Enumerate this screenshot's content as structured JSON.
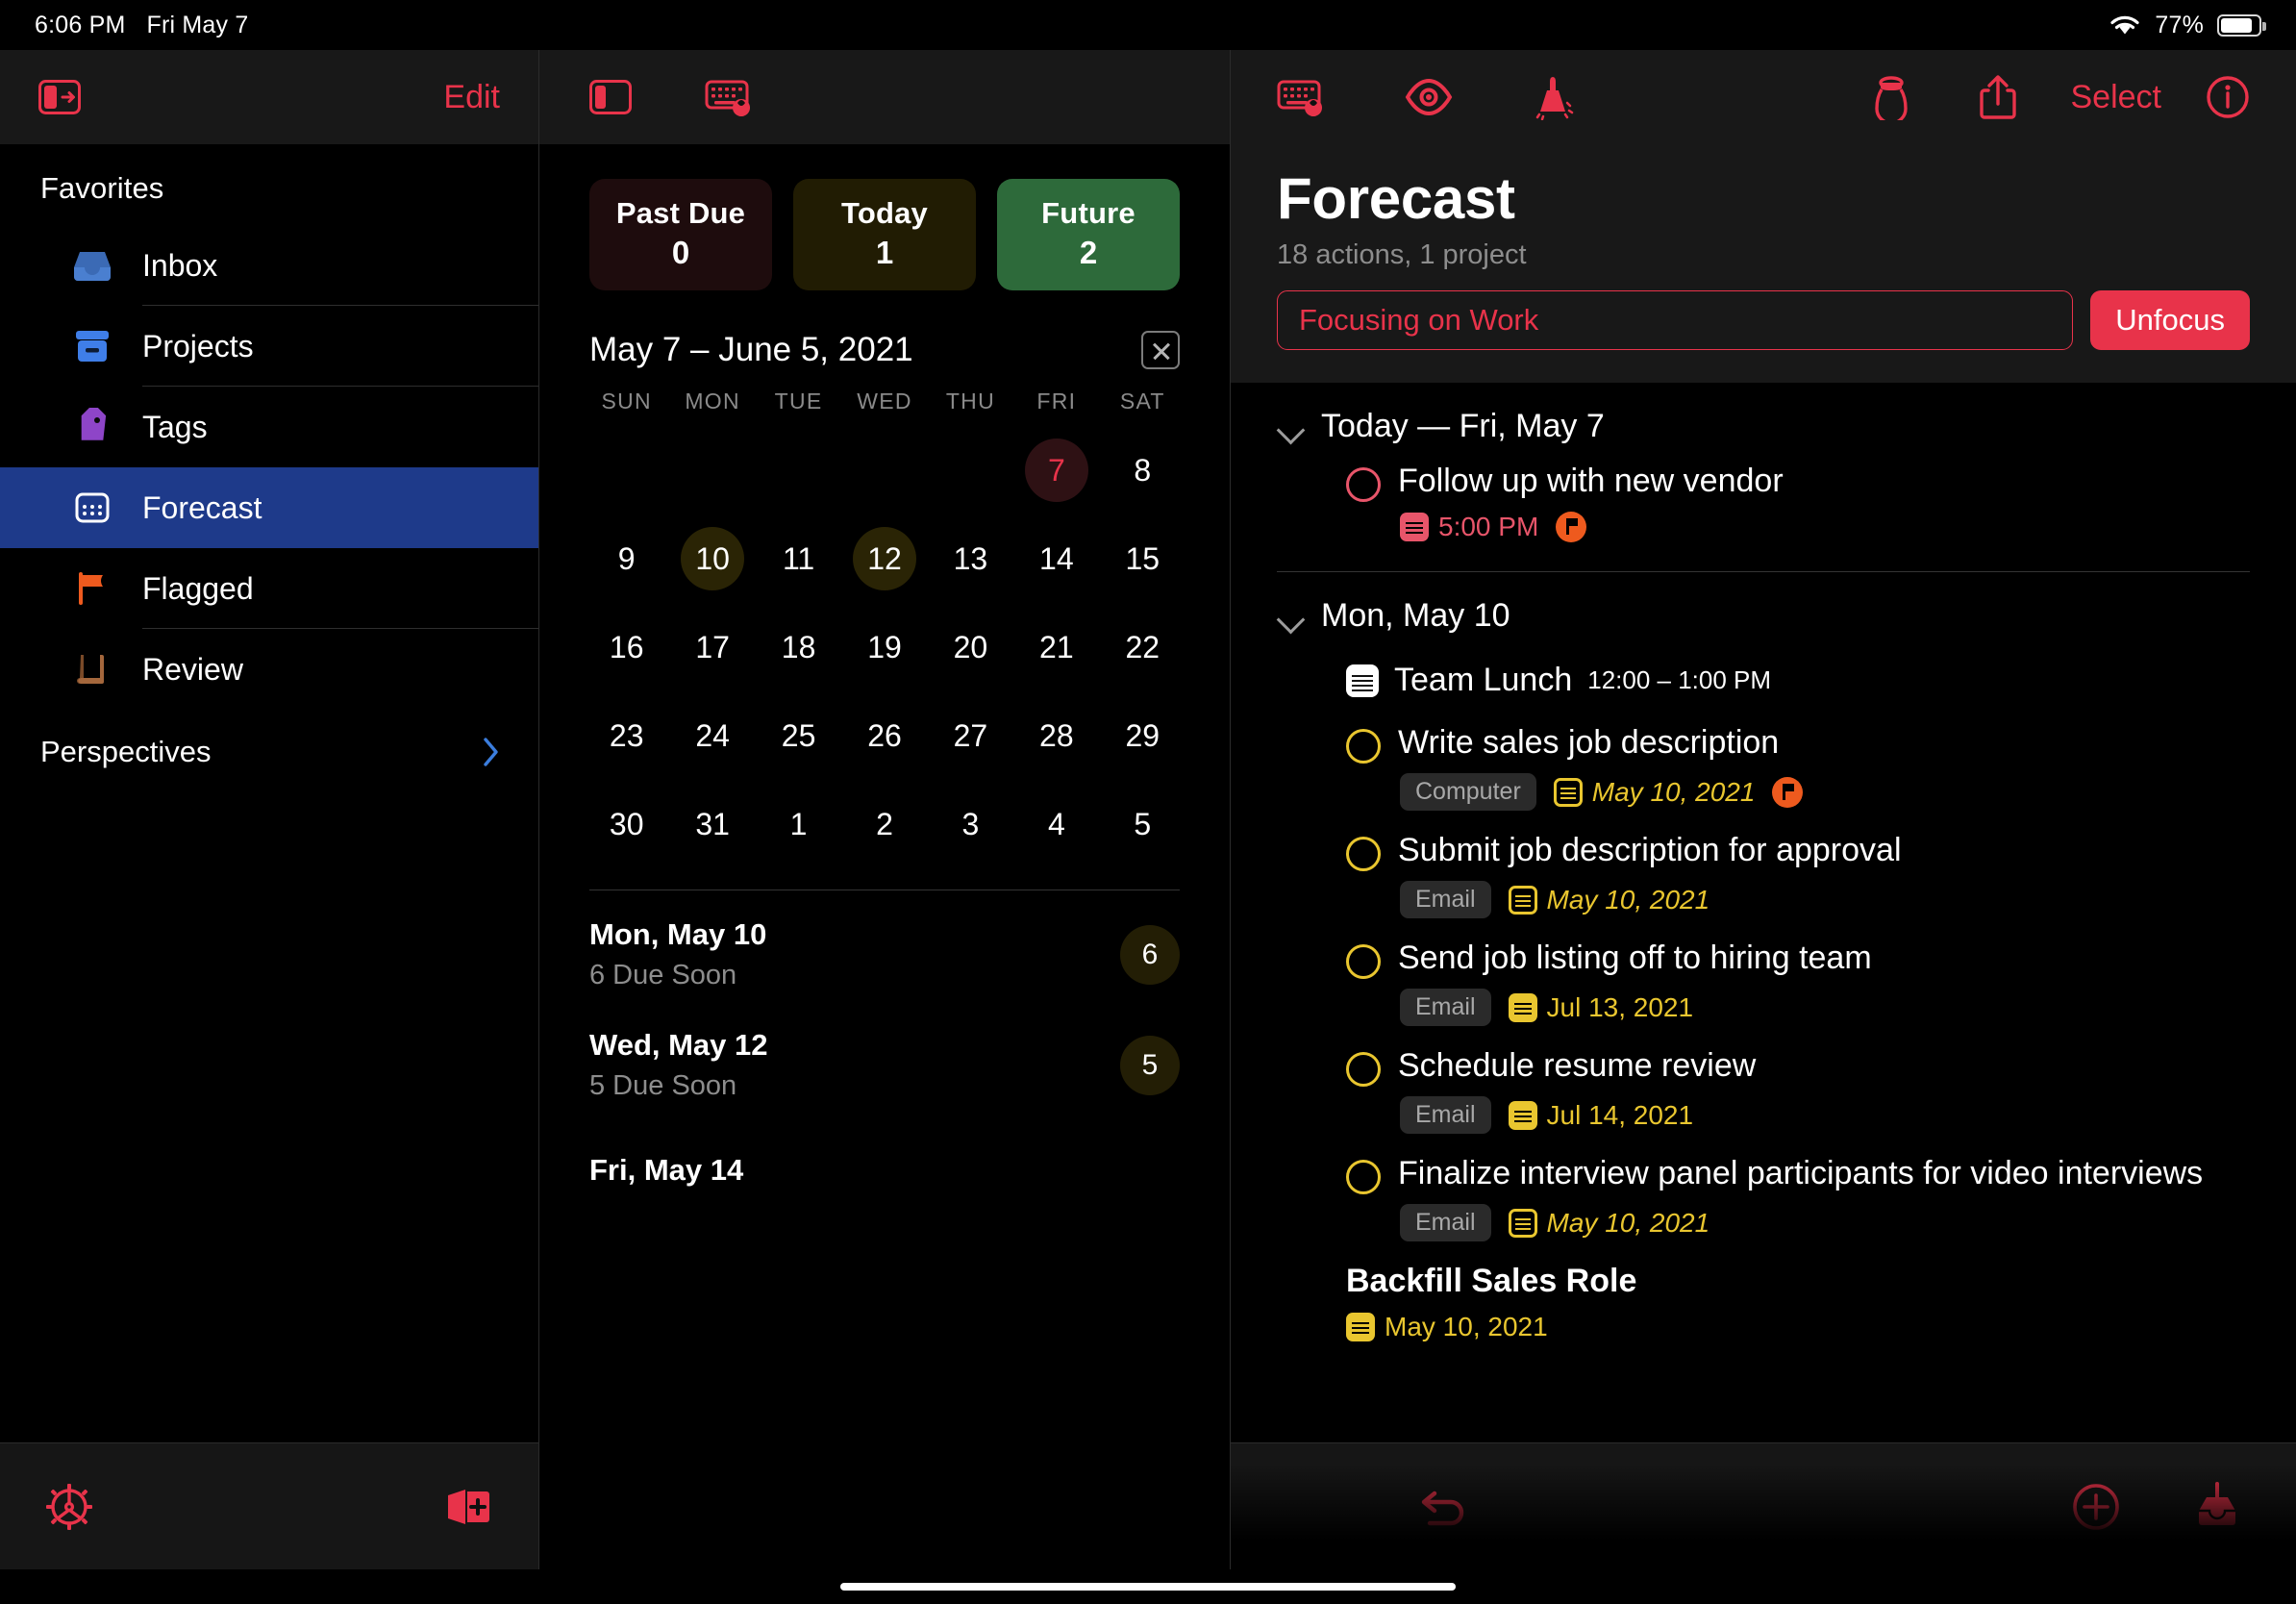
{
  "status_bar": {
    "time": "6:06 PM",
    "date": "Fri May 7",
    "battery_percent": "77%",
    "wifi_icon": "wifi-icon"
  },
  "sidebar": {
    "edit_label": "Edit",
    "sidebar_toggle_icon": "sidebar-hide-icon",
    "favorites_header": "Favorites",
    "items": [
      {
        "label": "Inbox",
        "icon": "inbox-icon",
        "selected": false
      },
      {
        "label": "Projects",
        "icon": "projects-box-icon",
        "selected": false
      },
      {
        "label": "Tags",
        "icon": "tag-icon",
        "selected": false
      },
      {
        "label": "Forecast",
        "icon": "calendar-icon",
        "selected": true
      },
      {
        "label": "Flagged",
        "icon": "flag-icon",
        "selected": false
      },
      {
        "label": "Review",
        "icon": "book-icon",
        "selected": false
      }
    ],
    "perspectives_label": "Perspectives",
    "perspectives_chevron_icon": "chevron-right-icon",
    "bottom_bar": {
      "settings_icon": "gear-icon",
      "add_perspective_icon": "add-perspective-icon"
    }
  },
  "middle": {
    "toolbar": {
      "sidebar_icon": "sidebar-toggle-icon",
      "keyboard_icon": "keyboard-shortcut-icon"
    },
    "badges": [
      {
        "title": "Past Due",
        "count": "0",
        "color": "#1e0c0d"
      },
      {
        "title": "Today",
        "count": "1",
        "color": "#211c03"
      },
      {
        "title": "Future",
        "count": "2",
        "color": "#2d6a3a"
      }
    ],
    "calendar": {
      "range_title": "May 7 – June 5, 2021",
      "close_icon": "close-icon",
      "day_headers": [
        "SUN",
        "MON",
        "TUE",
        "WED",
        "THU",
        "FRI",
        "SAT"
      ],
      "weeks": [
        [
          {
            "d": "",
            "s": "empty"
          },
          {
            "d": "",
            "s": "empty"
          },
          {
            "d": "",
            "s": "empty"
          },
          {
            "d": "",
            "s": "empty"
          },
          {
            "d": "",
            "s": "empty"
          },
          {
            "d": "7",
            "s": "today"
          },
          {
            "d": "8",
            "s": ""
          }
        ],
        [
          {
            "d": "9",
            "s": ""
          },
          {
            "d": "10",
            "s": "due"
          },
          {
            "d": "11",
            "s": ""
          },
          {
            "d": "12",
            "s": "due"
          },
          {
            "d": "13",
            "s": ""
          },
          {
            "d": "14",
            "s": ""
          },
          {
            "d": "15",
            "s": ""
          }
        ],
        [
          {
            "d": "16",
            "s": ""
          },
          {
            "d": "17",
            "s": ""
          },
          {
            "d": "18",
            "s": ""
          },
          {
            "d": "19",
            "s": ""
          },
          {
            "d": "20",
            "s": ""
          },
          {
            "d": "21",
            "s": ""
          },
          {
            "d": "22",
            "s": ""
          }
        ],
        [
          {
            "d": "23",
            "s": ""
          },
          {
            "d": "24",
            "s": ""
          },
          {
            "d": "25",
            "s": ""
          },
          {
            "d": "26",
            "s": ""
          },
          {
            "d": "27",
            "s": ""
          },
          {
            "d": "28",
            "s": ""
          },
          {
            "d": "29",
            "s": ""
          }
        ],
        [
          {
            "d": "30",
            "s": ""
          },
          {
            "d": "31",
            "s": ""
          },
          {
            "d": "1",
            "s": ""
          },
          {
            "d": "2",
            "s": ""
          },
          {
            "d": "3",
            "s": ""
          },
          {
            "d": "4",
            "s": ""
          },
          {
            "d": "5",
            "s": ""
          }
        ]
      ]
    },
    "day_list": [
      {
        "day": "Mon, May 10",
        "sub": "6 Due Soon",
        "count": "6"
      },
      {
        "day": "Wed, May 12",
        "sub": "5 Due Soon",
        "count": "5"
      },
      {
        "day": "Fri, May 14",
        "sub": "",
        "count": ""
      }
    ]
  },
  "main": {
    "toolbar": {
      "keyboard_icon": "keyboard-shortcut-icon",
      "view_icon": "eye-view-options-icon",
      "cleanup_icon": "broom-cleanup-icon",
      "focus_icon": "salt-shaker-focus-icon",
      "share_icon": "share-icon",
      "select_label": "Select",
      "info_icon": "info-icon"
    },
    "title": "Forecast",
    "subtitle": "18 actions, 1 project",
    "focus_value": "Focusing on Work",
    "unfocus_label": "Unfocus",
    "groups": [
      {
        "header": "Today — Fri, May 7",
        "rows": [
          {
            "kind": "task",
            "title": "Follow up with new vendor",
            "circle": "red",
            "tag": "",
            "date": "5:00 PM",
            "date_color": "red",
            "date_italic": false,
            "flagged": true
          }
        ]
      },
      {
        "header": "Mon, May 10",
        "rows": [
          {
            "kind": "event",
            "title": "Team Lunch",
            "time": "12:00 – 1:00 PM",
            "icon": "calendar-event-icon"
          },
          {
            "kind": "task",
            "title": "Write sales job description",
            "circle": "yellow",
            "tag": "Computer",
            "date": "May 10, 2021",
            "date_color": "yellow",
            "date_italic": true,
            "flagged": true
          },
          {
            "kind": "task",
            "title": "Submit job description for approval",
            "circle": "yellow",
            "tag": "Email",
            "date": "May 10, 2021",
            "date_color": "yellow",
            "date_italic": true,
            "flagged": false
          },
          {
            "kind": "task",
            "title": "Send job listing off to hiring team",
            "circle": "yellow",
            "tag": "Email",
            "date": "Jul 13, 2021",
            "date_color": "yellow",
            "date_italic": false,
            "flagged": false
          },
          {
            "kind": "task",
            "title": "Schedule resume review",
            "circle": "yellow",
            "tag": "Email",
            "date": "Jul 14, 2021",
            "date_color": "yellow",
            "date_italic": false,
            "flagged": false
          },
          {
            "kind": "task",
            "title": "Finalize interview panel participants for video interviews",
            "circle": "yellow",
            "tag": "Email",
            "date": "May 10, 2021",
            "date_color": "yellow",
            "date_italic": true,
            "flagged": false
          },
          {
            "kind": "project",
            "title": "Backfill Sales Role",
            "circle": "",
            "tag": "",
            "date": "May 10, 2021",
            "date_color": "yellow",
            "date_italic": false,
            "flagged": false
          }
        ]
      }
    ],
    "bottom_bar": {
      "undo_icon": "undo-icon",
      "add_icon": "add-item-icon",
      "inbox_icon": "quick-entry-inbox-icon"
    }
  },
  "colors": {
    "accent_red": "#e8334a",
    "selected_blue": "#1e3a8a",
    "due_yellow": "#e9c62f",
    "future_green": "#2d6a3a",
    "flag_orange": "#ee5a1e"
  }
}
